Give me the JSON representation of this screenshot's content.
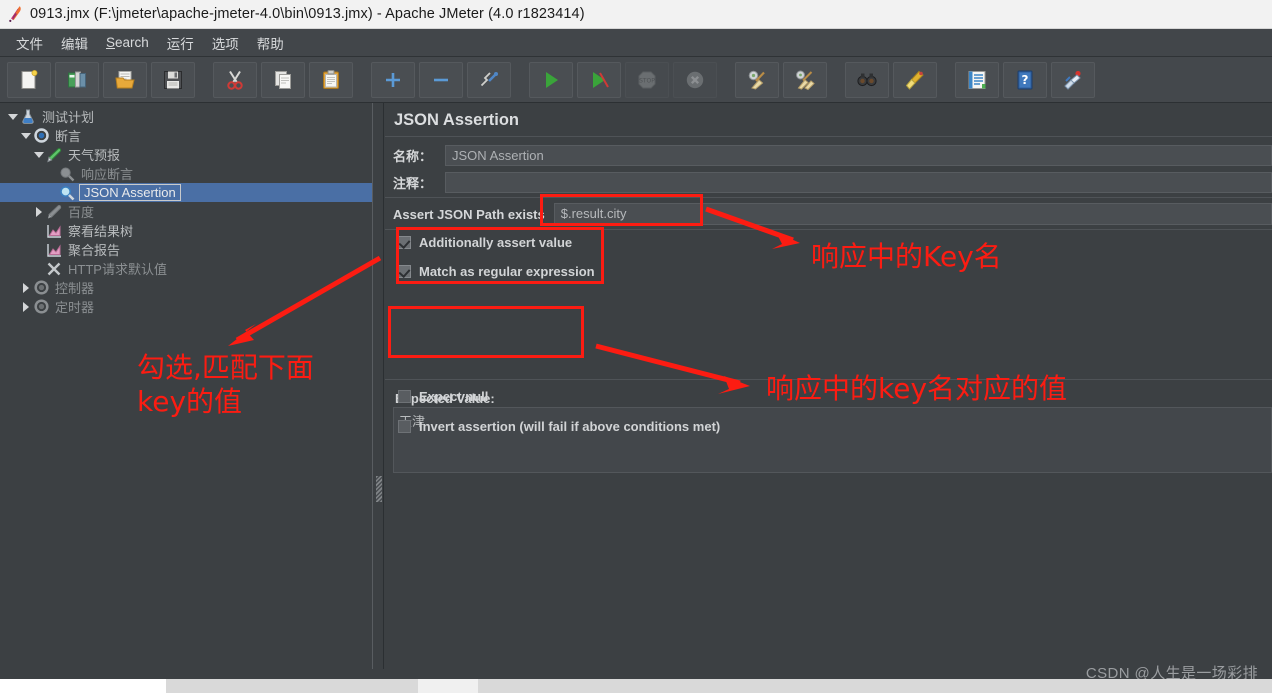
{
  "window": {
    "title": "0913.jmx (F:\\jmeter\\apache-jmeter-4.0\\bin\\0913.jmx) - Apache JMeter (4.0 r1823414)",
    "app_icon": "jmeter-feather-icon"
  },
  "menubar": {
    "items": [
      {
        "label": "文件",
        "mnemonic": ""
      },
      {
        "label": "编辑",
        "mnemonic": ""
      },
      {
        "label": "Search",
        "mnemonic": "S"
      },
      {
        "label": "运行",
        "mnemonic": ""
      },
      {
        "label": "选项",
        "mnemonic": ""
      },
      {
        "label": "帮助",
        "mnemonic": ""
      }
    ]
  },
  "toolbar": {
    "buttons": [
      {
        "name": "new-icon",
        "tooltip": "New"
      },
      {
        "name": "templates-icon",
        "tooltip": "Templates"
      },
      {
        "name": "open-icon",
        "tooltip": "Open"
      },
      {
        "name": "save-icon",
        "tooltip": "Save"
      },
      {
        "name": "cut-icon",
        "tooltip": "Cut"
      },
      {
        "name": "copy-icon",
        "tooltip": "Copy"
      },
      {
        "name": "paste-icon",
        "tooltip": "Paste"
      },
      {
        "name": "expand-all-icon",
        "tooltip": "Expand All"
      },
      {
        "name": "collapse-all-icon",
        "tooltip": "Collapse All"
      },
      {
        "name": "toggle-icon",
        "tooltip": "Toggle"
      },
      {
        "name": "start-icon",
        "tooltip": "Start"
      },
      {
        "name": "start-no-pauses-icon",
        "tooltip": "Start no pauses"
      },
      {
        "name": "stop-icon",
        "tooltip": "Stop"
      },
      {
        "name": "shutdown-icon",
        "tooltip": "Shutdown"
      },
      {
        "name": "clear-icon",
        "tooltip": "Clear"
      },
      {
        "name": "clear-all-icon",
        "tooltip": "Clear All"
      },
      {
        "name": "search-icon",
        "tooltip": "Search"
      },
      {
        "name": "reset-search-icon",
        "tooltip": "Reset Search"
      },
      {
        "name": "function-helper-icon",
        "tooltip": "Function Helper Dialog"
      },
      {
        "name": "help-icon",
        "tooltip": "Help"
      },
      {
        "name": "undo-redo-icon",
        "tooltip": "Undo"
      }
    ]
  },
  "tree": {
    "nodes": [
      {
        "label": "测试计划",
        "indent": 0,
        "twisty": "down",
        "icon": "test-plan-icon",
        "selected": false,
        "dim": false
      },
      {
        "label": "断言",
        "indent": 1,
        "twisty": "down",
        "icon": "thread-group-icon",
        "selected": false,
        "dim": false
      },
      {
        "label": "天气预报",
        "indent": 2,
        "twisty": "down",
        "icon": "http-request-icon",
        "selected": false,
        "dim": false
      },
      {
        "label": "响应断言",
        "indent": 3,
        "twisty": "none",
        "icon": "assertion-dim-icon",
        "selected": false,
        "dim": true
      },
      {
        "label": "JSON Assertion",
        "indent": 3,
        "twisty": "none",
        "icon": "assertion-icon",
        "selected": true,
        "dim": false
      },
      {
        "label": "百度",
        "indent": 2,
        "twisty": "right",
        "icon": "http-request-dim-icon",
        "selected": false,
        "dim": true
      },
      {
        "label": "察看结果树",
        "indent": 2,
        "twisty": "none",
        "icon": "view-results-icon",
        "selected": false,
        "dim": false
      },
      {
        "label": "聚合报告",
        "indent": 2,
        "twisty": "none",
        "icon": "aggregate-report-icon",
        "selected": false,
        "dim": false
      },
      {
        "label": "HTTP请求默认值",
        "indent": 2,
        "twisty": "none",
        "icon": "http-defaults-icon",
        "selected": false,
        "dim": true
      },
      {
        "label": "控制器",
        "indent": 1,
        "twisty": "right",
        "icon": "controller-icon",
        "selected": false,
        "dim": true
      },
      {
        "label": "定时器",
        "indent": 1,
        "twisty": "right",
        "icon": "timer-icon",
        "selected": false,
        "dim": true
      }
    ]
  },
  "editor": {
    "title": "JSON Assertion",
    "name_label": "名称：",
    "name_value": "JSON Assertion",
    "comment_label": "注释：",
    "comment_value": "",
    "jsonpath_label": "Assert JSON Path exists",
    "jsonpath_value": "$.result.city",
    "checkboxes": [
      {
        "label": "Additionally assert value",
        "checked": true,
        "name": "additionally-assert-value-checkbox"
      },
      {
        "label": "Match as regular expression",
        "checked": true,
        "name": "match-as-regex-checkbox"
      },
      {
        "label": "Expect null",
        "checked": false,
        "name": "expect-null-checkbox"
      },
      {
        "label": "Invert assertion (will fail if above conditions met)",
        "checked": false,
        "name": "invert-assertion-checkbox"
      }
    ],
    "expected_value_label": "Expected Value:",
    "expected_value": "天津"
  },
  "annotations": {
    "color": "#fc1c12",
    "texts": [
      {
        "id": "key-name-note",
        "lines": "响应中的Key名"
      },
      {
        "id": "check-note",
        "lines": "勾选,匹配下面\nkey的值"
      },
      {
        "id": "value-note",
        "lines": "响应中的key名对应的值"
      }
    ]
  },
  "watermark": {
    "text": "CSDN @人生是一场彩排"
  }
}
